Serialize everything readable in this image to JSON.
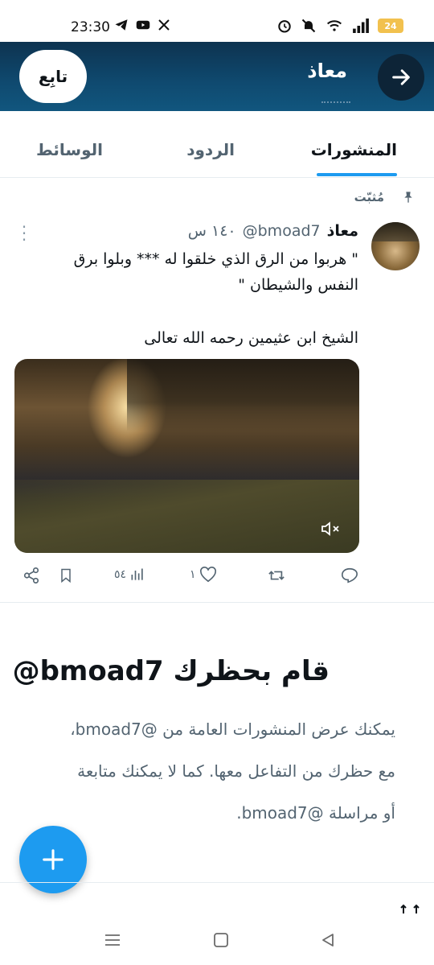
{
  "status_bar": {
    "time": "23:30",
    "battery": "24"
  },
  "header": {
    "title": "معاذ",
    "follow_label": "تابِع"
  },
  "tabs": [
    {
      "label": "المنشورات",
      "active": true
    },
    {
      "label": "الردود",
      "active": false
    },
    {
      "label": "الوسائط",
      "active": false
    }
  ],
  "post": {
    "pinned_label": "مُثبّت",
    "name": "معاذ",
    "handle": "@bmoad7",
    "time": "١٤٠ س",
    "text_line1": "\" هربوا من الرق الذي خلقوا له *** وبلوا برق",
    "text_line2": "النفس والشيطان \"",
    "text_line3": "الشيخ ابن عثيمين رحمه الله تعالى",
    "actions": {
      "likes": "١",
      "views": "٥٤"
    }
  },
  "blocked": {
    "title": "قام بحظرك",
    "handle": "@bmoad7",
    "body_line1": "يمكنك عرض المنشورات العامة من @bmoad7،",
    "body_line2": "مع حظرك من التفاعل معها. كما لا يمكنك متابعة",
    "body_line3": "أو مراسلة @bmoad7."
  },
  "colors": {
    "accent": "#1d9bf0",
    "header_bg": "#0f4a70",
    "muted_text": "#536471"
  }
}
